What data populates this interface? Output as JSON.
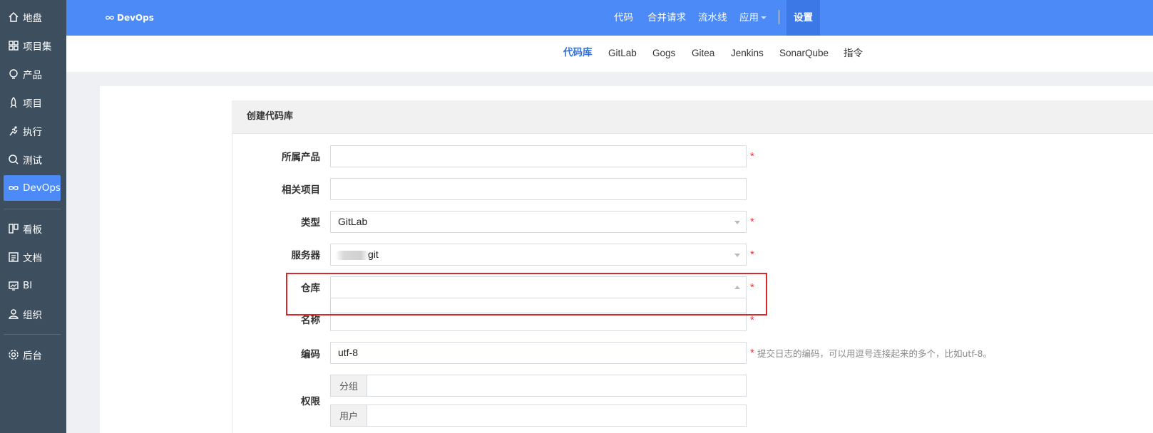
{
  "sidebar": {
    "items": [
      {
        "label": "地盘",
        "icon": "home-icon"
      },
      {
        "label": "项目集",
        "icon": "grid-icon"
      },
      {
        "label": "产品",
        "icon": "bulb-icon"
      },
      {
        "label": "项目",
        "icon": "rocket-icon"
      },
      {
        "label": "执行",
        "icon": "run-icon"
      },
      {
        "label": "测试",
        "icon": "search-icon"
      },
      {
        "label": "DevOps",
        "icon": "infinity-icon",
        "active": true
      },
      {
        "label": "看板",
        "icon": "kanban-icon"
      },
      {
        "label": "文档",
        "icon": "doc-icon"
      },
      {
        "label": "BI",
        "icon": "monitor-icon"
      },
      {
        "label": "组织",
        "icon": "user-icon"
      },
      {
        "label": "后台",
        "icon": "gear-icon"
      }
    ]
  },
  "header": {
    "brand": "DevOps",
    "nav": [
      "代码",
      "合并请求",
      "流水线",
      "应用",
      "设置"
    ],
    "active": "设置"
  },
  "subnav": {
    "items": [
      "代码库",
      "GitLab",
      "Gogs",
      "Gitea",
      "Jenkins",
      "SonarQube",
      "指令"
    ],
    "active": "代码库"
  },
  "form": {
    "title": "创建代码库",
    "fields": {
      "product": {
        "label": "所属产品",
        "value": ""
      },
      "project": {
        "label": "相关项目",
        "value": ""
      },
      "type": {
        "label": "类型",
        "value": "GitLab"
      },
      "server": {
        "label": "服务器",
        "value": "git"
      },
      "repo": {
        "label": "仓库",
        "value": ""
      },
      "name": {
        "label": "名称",
        "value": ""
      },
      "encoding": {
        "label": "编码",
        "value": "utf-8",
        "hint": "提交日志的编码，可以用逗号连接起来的多个，比如utf-8。"
      },
      "permission": {
        "label": "权限",
        "group_label": "分组",
        "user_label": "用户"
      }
    },
    "required_mark": "*"
  },
  "colors": {
    "primary": "#4b8af7",
    "sidebar": "#3d4f5f",
    "required": "#e0393e",
    "highlight": "#d9272e"
  }
}
